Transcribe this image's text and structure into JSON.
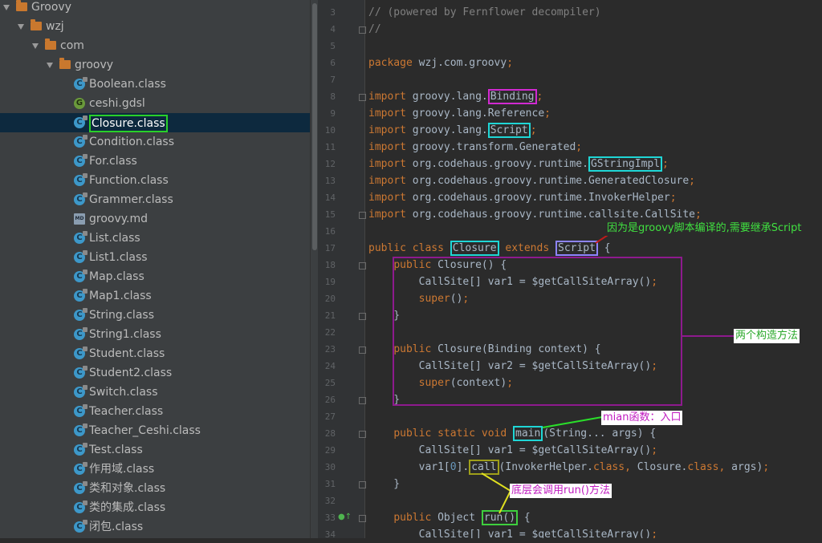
{
  "tree": {
    "nodes": [
      {
        "label": "Groovy",
        "type": "folder",
        "depth": 0
      },
      {
        "label": "wzj",
        "type": "folder",
        "depth": 1
      },
      {
        "label": "com",
        "type": "folder",
        "depth": 2
      },
      {
        "label": "groovy",
        "type": "folder",
        "depth": 3
      },
      {
        "label": "Boolean.class",
        "type": "class",
        "depth": 4
      },
      {
        "label": "ceshi.gdsl",
        "type": "gdsl",
        "depth": 4
      },
      {
        "label": "Closure.class",
        "type": "class",
        "depth": 4,
        "selected": true
      },
      {
        "label": "Condition.class",
        "type": "class",
        "depth": 4
      },
      {
        "label": "For.class",
        "type": "class",
        "depth": 4
      },
      {
        "label": "Function.class",
        "type": "class",
        "depth": 4
      },
      {
        "label": "Grammer.class",
        "type": "class",
        "depth": 4
      },
      {
        "label": "groovy.md",
        "type": "md",
        "depth": 4
      },
      {
        "label": "List.class",
        "type": "class",
        "depth": 4
      },
      {
        "label": "List1.class",
        "type": "class",
        "depth": 4
      },
      {
        "label": "Map.class",
        "type": "class",
        "depth": 4
      },
      {
        "label": "Map1.class",
        "type": "class",
        "depth": 4
      },
      {
        "label": "String.class",
        "type": "class",
        "depth": 4
      },
      {
        "label": "String1.class",
        "type": "class",
        "depth": 4
      },
      {
        "label": "Student.class",
        "type": "class",
        "depth": 4
      },
      {
        "label": "Student2.class",
        "type": "class",
        "depth": 4
      },
      {
        "label": "Switch.class",
        "type": "class",
        "depth": 4
      },
      {
        "label": "Teacher.class",
        "type": "class",
        "depth": 4
      },
      {
        "label": "Teacher_Ceshi.class",
        "type": "class",
        "depth": 4
      },
      {
        "label": "Test.class",
        "type": "class",
        "depth": 4
      },
      {
        "label": "作用域.class",
        "type": "class",
        "depth": 4
      },
      {
        "label": "类和对象.class",
        "type": "class",
        "depth": 4
      },
      {
        "label": "类的集成.class",
        "type": "class",
        "depth": 4
      },
      {
        "label": "闭包.class",
        "type": "class",
        "depth": 4
      }
    ]
  },
  "editor": {
    "lines": [
      {
        "n": "3",
        "fold": false,
        "parts": [
          [
            "cm",
            "// (powered by Fernflower decompiler)"
          ]
        ]
      },
      {
        "n": "4",
        "fold": true,
        "parts": [
          [
            "cm",
            "//"
          ]
        ]
      },
      {
        "n": "5",
        "fold": false,
        "parts": []
      },
      {
        "n": "6",
        "fold": false,
        "parts": [
          [
            "kw",
            "package "
          ],
          [
            "t",
            "wzj.com.groovy"
          ],
          [
            "kw",
            ";"
          ]
        ]
      },
      {
        "n": "7",
        "fold": false,
        "parts": []
      },
      {
        "n": "8",
        "fold": true,
        "parts": [
          [
            "kw",
            "import "
          ],
          [
            "t",
            "groovy.lang."
          ],
          [
            "b-magenta",
            "Binding"
          ],
          [
            "kw",
            ";"
          ]
        ]
      },
      {
        "n": "9",
        "fold": false,
        "parts": [
          [
            "kw",
            "import "
          ],
          [
            "t",
            "groovy.lang.Reference"
          ],
          [
            "kw",
            ";"
          ]
        ]
      },
      {
        "n": "10",
        "fold": false,
        "parts": [
          [
            "kw",
            "import "
          ],
          [
            "t",
            "groovy.lang."
          ],
          [
            "b-cyan",
            "Script"
          ],
          [
            "kw",
            ";"
          ]
        ]
      },
      {
        "n": "11",
        "fold": false,
        "parts": [
          [
            "kw",
            "import "
          ],
          [
            "t",
            "groovy.transform.Generated"
          ],
          [
            "kw",
            ";"
          ]
        ]
      },
      {
        "n": "12",
        "fold": false,
        "parts": [
          [
            "kw",
            "import "
          ],
          [
            "t",
            "org.codehaus.groovy.runtime."
          ],
          [
            "b-cyan",
            "GStringImpl"
          ],
          [
            "kw",
            ";"
          ]
        ]
      },
      {
        "n": "13",
        "fold": false,
        "parts": [
          [
            "kw",
            "import "
          ],
          [
            "t",
            "org.codehaus.groovy.runtime.GeneratedClosure"
          ],
          [
            "kw",
            ";"
          ]
        ]
      },
      {
        "n": "14",
        "fold": false,
        "parts": [
          [
            "kw",
            "import "
          ],
          [
            "t",
            "org.codehaus.groovy.runtime.InvokerHelper"
          ],
          [
            "kw",
            ";"
          ]
        ]
      },
      {
        "n": "15",
        "fold": true,
        "parts": [
          [
            "kw",
            "import "
          ],
          [
            "t",
            "org.codehaus.groovy.runtime.callsite.CallSite"
          ],
          [
            "kw",
            ";"
          ]
        ]
      },
      {
        "n": "16",
        "fold": false,
        "parts": []
      },
      {
        "n": "17",
        "fold": false,
        "parts": [
          [
            "kw",
            "public class "
          ],
          [
            "b-cyan",
            "Closure"
          ],
          [
            "kw",
            " extends "
          ],
          [
            "b-violet",
            "Script"
          ],
          [
            "t",
            " {"
          ]
        ]
      },
      {
        "n": "18",
        "fold": true,
        "parts": [
          [
            "t",
            "    "
          ],
          [
            "kw",
            "public "
          ],
          [
            "t",
            "Closure() {"
          ]
        ]
      },
      {
        "n": "19",
        "fold": false,
        "parts": [
          [
            "t",
            "        CallSite[] var1 = $getCallSiteArray()"
          ],
          [
            "kw",
            ";"
          ]
        ]
      },
      {
        "n": "20",
        "fold": false,
        "parts": [
          [
            "t",
            "        "
          ],
          [
            "kw",
            "super"
          ],
          [
            "t",
            "()"
          ],
          [
            "kw",
            ";"
          ]
        ]
      },
      {
        "n": "21",
        "fold": true,
        "parts": [
          [
            "t",
            "    }"
          ]
        ]
      },
      {
        "n": "22",
        "fold": false,
        "parts": []
      },
      {
        "n": "23",
        "fold": true,
        "parts": [
          [
            "t",
            "    "
          ],
          [
            "kw",
            "public "
          ],
          [
            "t",
            "Closure(Binding context) {"
          ]
        ]
      },
      {
        "n": "24",
        "fold": false,
        "parts": [
          [
            "t",
            "        CallSite[] var2 = $getCallSiteArray()"
          ],
          [
            "kw",
            ";"
          ]
        ]
      },
      {
        "n": "25",
        "fold": false,
        "parts": [
          [
            "t",
            "        "
          ],
          [
            "kw",
            "super"
          ],
          [
            "t",
            "(context)"
          ],
          [
            "kw",
            ";"
          ]
        ]
      },
      {
        "n": "26",
        "fold": true,
        "parts": [
          [
            "t",
            "    }"
          ]
        ]
      },
      {
        "n": "27",
        "fold": false,
        "parts": []
      },
      {
        "n": "28",
        "fold": true,
        "parts": [
          [
            "t",
            "    "
          ],
          [
            "kw",
            "public static void "
          ],
          [
            "b-cyan",
            "main"
          ],
          [
            "t",
            "(String... args) {"
          ]
        ]
      },
      {
        "n": "29",
        "fold": false,
        "parts": [
          [
            "t",
            "        CallSite[] var1 = $getCallSiteArray()"
          ],
          [
            "kw",
            ";"
          ]
        ]
      },
      {
        "n": "30",
        "fold": false,
        "parts": [
          [
            "t",
            "        var1["
          ],
          [
            "num",
            "0"
          ],
          [
            "t",
            "]."
          ],
          [
            "b-olive",
            "call"
          ],
          [
            "t",
            "(InvokerHelper."
          ],
          [
            "kw",
            "class, "
          ],
          [
            "t",
            "Closure."
          ],
          [
            "kw",
            "class, "
          ],
          [
            "t",
            "args)"
          ],
          [
            "kw",
            ";"
          ]
        ]
      },
      {
        "n": "31",
        "fold": true,
        "parts": [
          [
            "t",
            "    }"
          ]
        ]
      },
      {
        "n": "32",
        "fold": false,
        "parts": []
      },
      {
        "n": "33",
        "fold": true,
        "mark": true,
        "parts": [
          [
            "t",
            "    "
          ],
          [
            "kw",
            "public "
          ],
          [
            "t",
            "Object "
          ],
          [
            "b-green",
            "run()"
          ],
          [
            "t",
            " {"
          ]
        ]
      },
      {
        "n": "34",
        "fold": false,
        "parts": [
          [
            "t",
            "        CallSite[] var1 = $getCallSiteArray()"
          ],
          [
            "kw",
            ";"
          ]
        ]
      }
    ]
  },
  "annotations": {
    "script": "因为是groovy脚本编译的,需要继承Script",
    "constructors": "两个构造方法",
    "main": "mian函数：入口",
    "run": "底层会调用run()方法"
  },
  "colors": {
    "accent_green": "#29d029",
    "annotation_bg": "#ffffff",
    "annotation_green": "#3ecf3e",
    "annotation_magenta": "#d129d1",
    "code_keyword": "#cc7832",
    "code_comment": "#808080"
  }
}
